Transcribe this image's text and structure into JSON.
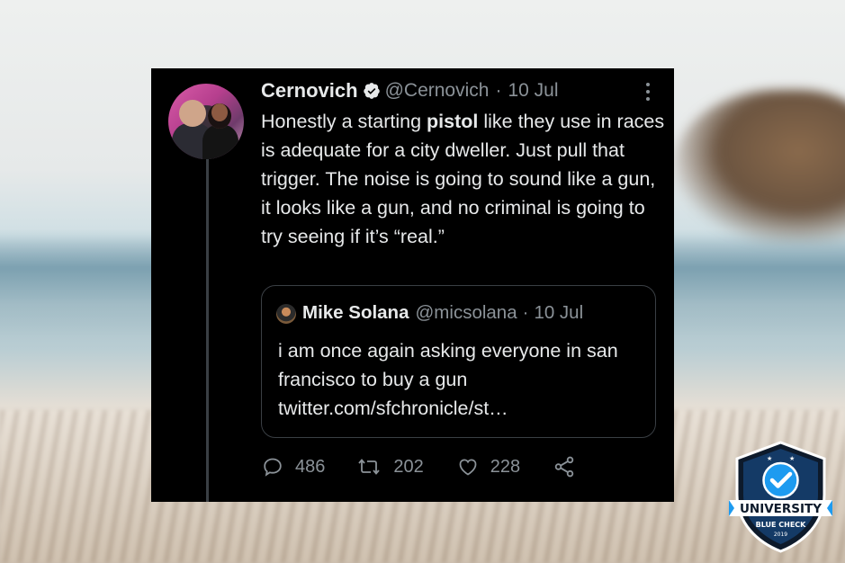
{
  "tweet": {
    "author_name": "Cernovich",
    "author_handle": "@Cernovich",
    "separator": "·",
    "date": "10 Jul",
    "text_before": "Honestly a starting ",
    "text_bold": "pistol",
    "text_after": " like they use in races is adequate for a city dweller. Just pull that trigger. The noise is going to sound like a gun, it looks like a gun, and no criminal is going to try seeing if it’s “real.”",
    "quoted": {
      "author_name": "Mike Solana",
      "author_handle": "@micsolana",
      "separator": "·",
      "date": "10 Jul",
      "text": "i am once again asking everyone in san francisco to buy a gun twitter.com/sfchronicle/st…"
    },
    "actions": {
      "replies": "486",
      "retweets": "202",
      "likes": "228"
    }
  },
  "icons": {
    "verified": "verified-badge-icon",
    "more": "more-vertical-icon",
    "reply": "reply-icon",
    "retweet": "retweet-icon",
    "like": "heart-icon",
    "share": "share-icon"
  },
  "badge": {
    "line1": "UNIVERSITY",
    "line2": "BLUE CHECK",
    "year": "2019"
  },
  "colors": {
    "tweet_background": "#000000",
    "text": "#e7e9ea",
    "secondary_text": "#8b9298",
    "badge_blue": "#1d9bf0"
  }
}
